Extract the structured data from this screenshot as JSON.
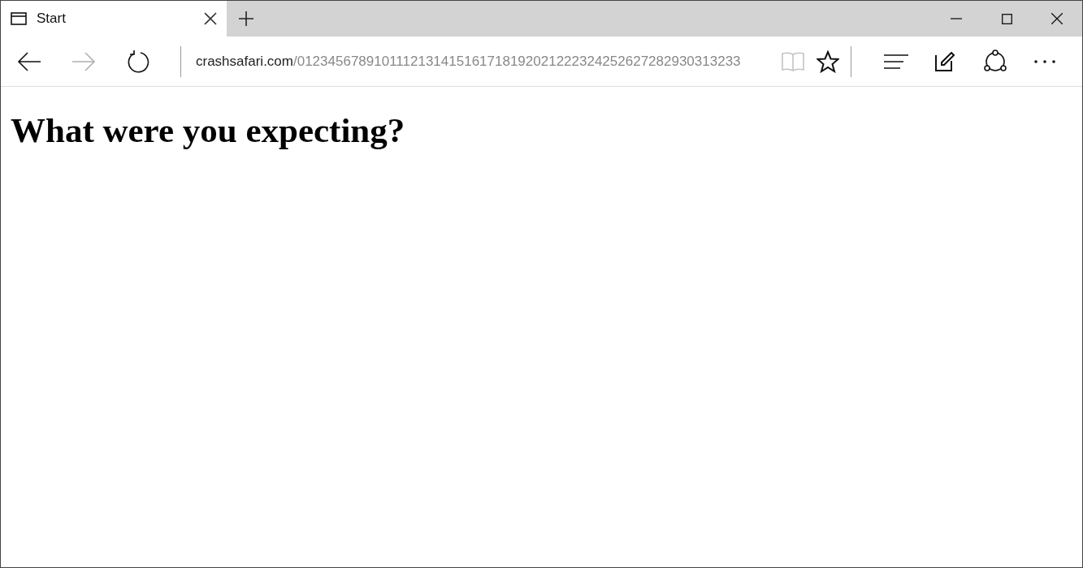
{
  "tab": {
    "title": "Start",
    "selected": true
  },
  "nav": {
    "back_disabled": false,
    "forward_disabled": true
  },
  "address": {
    "domain": "crashsafari.com",
    "path": "/0123456789101112131415161718192021222324252627282930313233"
  },
  "reading_view_disabled": true,
  "page": {
    "heading": "What were you expecting?"
  }
}
